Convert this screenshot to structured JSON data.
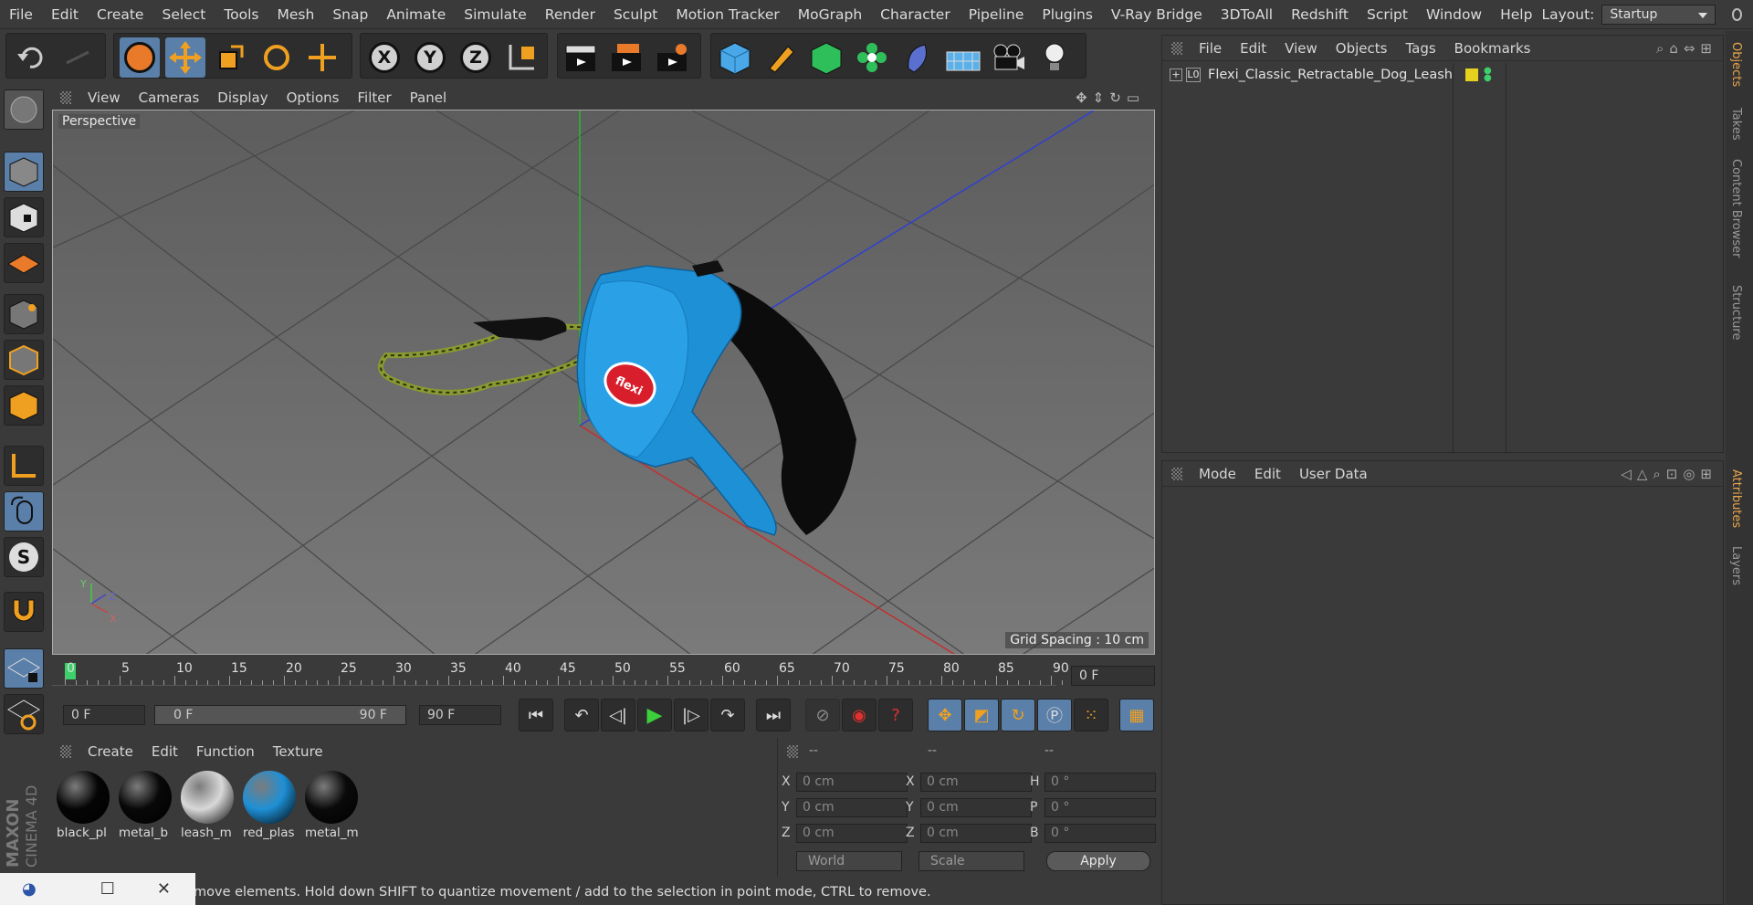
{
  "menubar": {
    "items": [
      "File",
      "Edit",
      "Create",
      "Select",
      "Tools",
      "Mesh",
      "Snap",
      "Animate",
      "Simulate",
      "Render",
      "Sculpt",
      "Motion Tracker",
      "MoGraph",
      "Character",
      "Pipeline",
      "Plugins",
      "V-Ray Bridge",
      "3DToAll",
      "Redshift",
      "Script",
      "Window",
      "Help"
    ],
    "layout_label": "Layout:",
    "layout_value": "Startup"
  },
  "viewport": {
    "menu": [
      "View",
      "Cameras",
      "Display",
      "Options",
      "Filter",
      "Panel"
    ],
    "label": "Perspective",
    "grid_spacing": "Grid Spacing : 10 cm",
    "axis_y": "Y",
    "axis_z": "Z",
    "axis_x": "X",
    "logo_text": "flexi"
  },
  "timeline": {
    "ticks": [
      "0",
      "5",
      "10",
      "15",
      "20",
      "25",
      "30",
      "35",
      "40",
      "45",
      "50",
      "55",
      "60",
      "65",
      "70",
      "75",
      "80",
      "85",
      "90"
    ],
    "current_frame": "0 F"
  },
  "transport": {
    "start_field": "0 F",
    "range_start": "0 F",
    "range_end": "90 F",
    "end_field": "90 F"
  },
  "materials": {
    "menu": [
      "Create",
      "Edit",
      "Function",
      "Texture"
    ],
    "items": [
      {
        "name": "black_pl",
        "color": "#050505"
      },
      {
        "name": "metal_b",
        "color": "#080808"
      },
      {
        "name": "leash_m",
        "color": "#d8d8d8"
      },
      {
        "name": "red_plas",
        "color": "#1e90d6"
      },
      {
        "name": "metal_m",
        "color": "#0a0a0a"
      }
    ]
  },
  "coords": {
    "headers": [
      "--",
      "--",
      "--"
    ],
    "rows": [
      {
        "l1": "X",
        "v1": "0 cm",
        "l2": "X",
        "v2": "0 cm",
        "l3": "H",
        "v3": "0 °"
      },
      {
        "l1": "Y",
        "v1": "0 cm",
        "l2": "Y",
        "v2": "0 cm",
        "l3": "P",
        "v3": "0 °"
      },
      {
        "l1": "Z",
        "v1": "0 cm",
        "l2": "Z",
        "v2": "0 cm",
        "l3": "B",
        "v3": "0 °"
      }
    ],
    "world": "World",
    "scale": "Scale",
    "apply": "Apply"
  },
  "objects": {
    "menu": [
      "File",
      "Edit",
      "View",
      "Objects",
      "Tags",
      "Bookmarks"
    ],
    "item": "Flexi_Classic_Retractable_Dog_Leash",
    "tag_color": "#e6d21e"
  },
  "attributes": {
    "menu": [
      "Mode",
      "Edit",
      "User Data"
    ]
  },
  "right_tabs": [
    "Objects",
    "Takes",
    "Content Browser",
    "Structure",
    "Attributes",
    "Layers"
  ],
  "status": {
    "text": "move elements. Hold down SHIFT to quantize movement / add to the selection in point mode, CTRL to remove."
  },
  "brand": {
    "line1": "MAXON",
    "line2": "CINEMA 4D"
  },
  "colors": {
    "accent": "#5a7fa8",
    "leash_blue": "#1e90d6",
    "orange": "#e8a64b"
  }
}
